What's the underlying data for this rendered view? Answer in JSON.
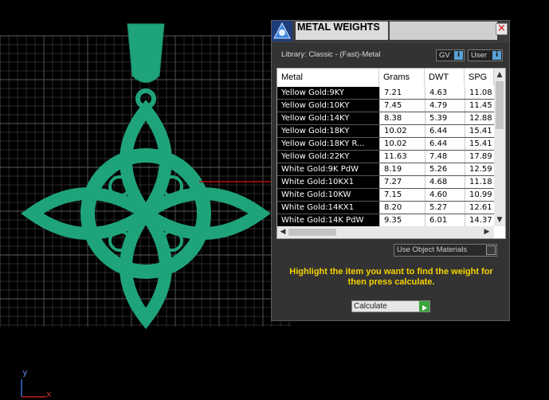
{
  "dialog": {
    "title": "METAL WEIGHTS",
    "close_icon": "close-icon",
    "library_label": "Library: Classic - (Fast)-Metal",
    "gv_label": "GV",
    "user_label": "User",
    "toggle_glyph": "i",
    "use_object_materials_label": "Use Object Materials",
    "instructions": "Highlight the item you want to find the weight for then press calculate.",
    "calculate_label": "Calculate"
  },
  "table": {
    "headers": [
      "Metal",
      "Grams",
      "DWT",
      "SPG"
    ],
    "rows": [
      [
        "Yellow Gold:9KY",
        "7.21",
        "4.63",
        "11.08"
      ],
      [
        "Yellow Gold:10KY",
        "7.45",
        "4.79",
        "11.45"
      ],
      [
        "Yellow Gold:14KY",
        "8.38",
        "5.39",
        "12.88"
      ],
      [
        "Yellow Gold:18KY",
        "10.02",
        "6.44",
        "15.41"
      ],
      [
        "Yellow Gold:18KY R...",
        "10.02",
        "6.44",
        "15.41"
      ],
      [
        "Yellow Gold:22KY",
        "11.63",
        "7.48",
        "17.89"
      ],
      [
        "White Gold:9K PdW",
        "8.19",
        "5.26",
        "12.59"
      ],
      [
        "White Gold:10KX1",
        "7.27",
        "4.68",
        "11.18"
      ],
      [
        "White Gold:10KW",
        "7.15",
        "4.60",
        "10.99"
      ],
      [
        "White Gold:14KX1",
        "8.20",
        "5.27",
        "12.61"
      ],
      [
        "White Gold:14K PdW",
        "9.35",
        "6.01",
        "14.37"
      ]
    ]
  },
  "viewport": {
    "axis_y_label": "y",
    "axis_x_label": "x"
  },
  "colors": {
    "background": "#000000",
    "grid": "#5a5a5a",
    "pendant": "#1fa37a",
    "instruction_text": "#f5d200",
    "toggle_accent": "#5aa2d8",
    "calc_accent": "#3aa53a"
  }
}
